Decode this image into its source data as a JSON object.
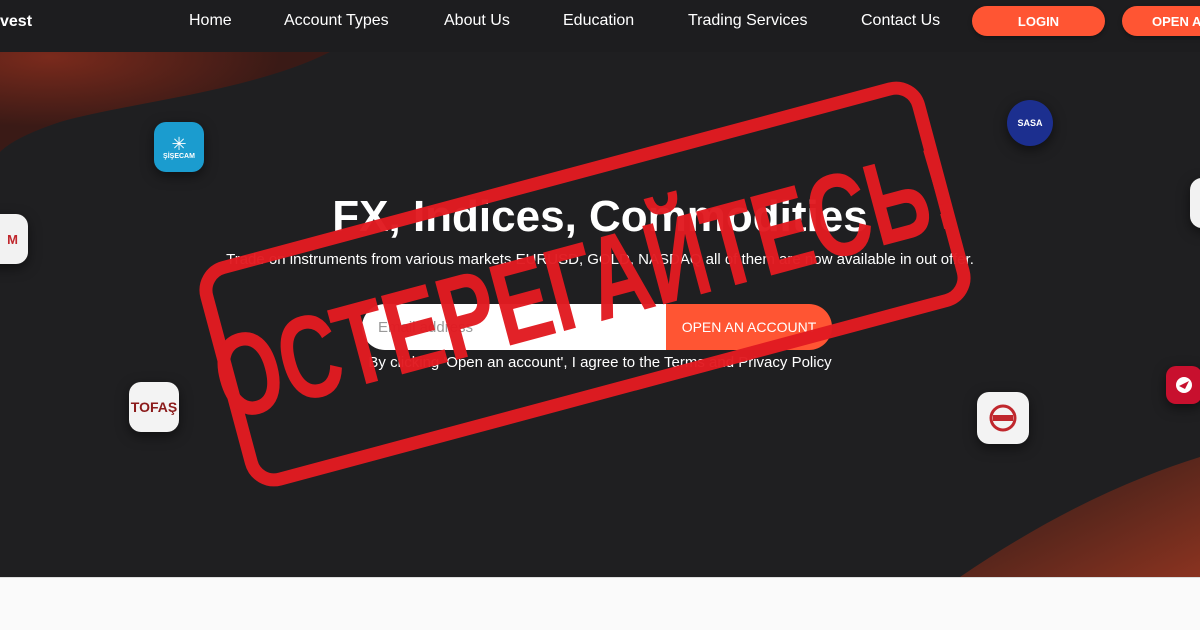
{
  "header": {
    "logo_text": "vest",
    "nav": [
      "Home",
      "Account Types",
      "About Us",
      "Education",
      "Trading Services",
      "Contact Us"
    ],
    "login_label": "LOGIN",
    "open_label": "OPEN A"
  },
  "hero": {
    "title": "FX, Indices, Commodities",
    "subtitle": "Trade on instruments from various markets EURUSD, GOLD, NASDAQ all of them are now available in out offer.",
    "email_placeholder": "Email address",
    "open_button": "OPEN AN ACCOUNT",
    "disclaimer": "By clicking 'Open an account', I agree to the Terms and Privacy Policy"
  },
  "logos": {
    "sisecam": "ŞİŞECAM",
    "sasa": "SASA",
    "tofas": "TOFAŞ",
    "left_partial": "M"
  },
  "stamp": {
    "text": "ОСТЕРЕГАЙТЕСЬ!",
    "color": "#e21b22"
  },
  "colors": {
    "accent": "#ff5533",
    "background": "#1f1f21"
  }
}
